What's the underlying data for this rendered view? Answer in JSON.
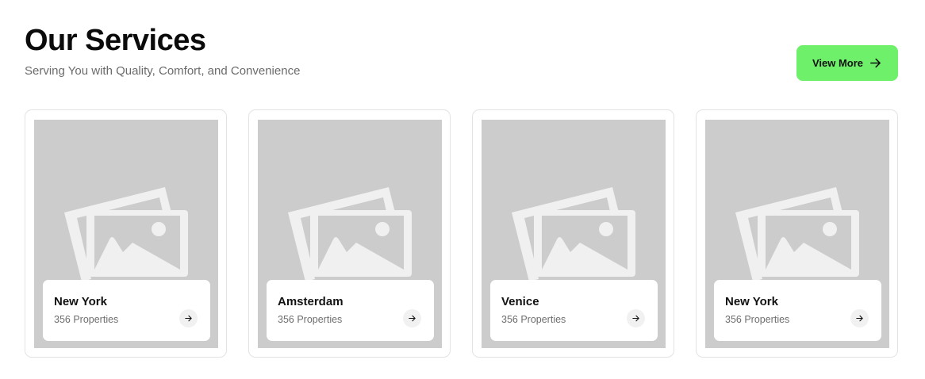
{
  "header": {
    "title": "Our Services",
    "subtitle": "Serving You with Quality, Comfort, and Convenience"
  },
  "view_more": {
    "label": "View More",
    "icon": "arrow-right-icon",
    "color": "#6ef06a"
  },
  "cards": [
    {
      "city": "New York",
      "properties": "356 Properties",
      "image_icon": "image-placeholder-icon",
      "arrow_icon": "arrow-right-icon"
    },
    {
      "city": "Amsterdam",
      "properties": "356 Properties",
      "image_icon": "image-placeholder-icon",
      "arrow_icon": "arrow-right-icon"
    },
    {
      "city": "Venice",
      "properties": "356 Properties",
      "image_icon": "image-placeholder-icon",
      "arrow_icon": "arrow-right-icon"
    },
    {
      "city": "New York",
      "properties": "356 Properties",
      "image_icon": "image-placeholder-icon",
      "arrow_icon": "arrow-right-icon"
    }
  ],
  "colors": {
    "placeholder_bg": "#cccccc",
    "placeholder_icon": "#f0f0f0"
  }
}
